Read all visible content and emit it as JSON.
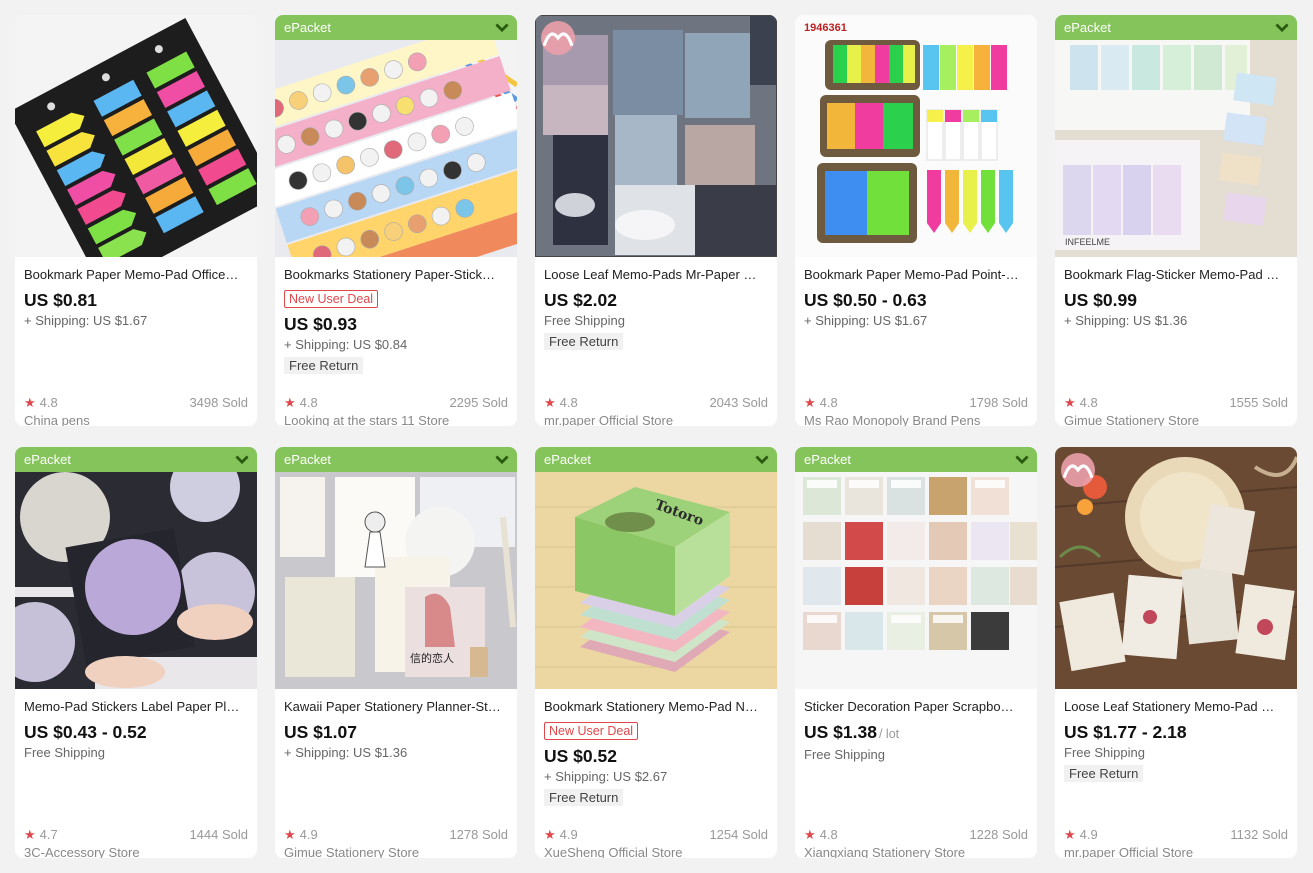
{
  "colors": {
    "epacket_bg": "#84c45a",
    "deal_red": "#e0484b",
    "star_red": "#e0484b"
  },
  "products": [
    {
      "title": "Bookmark Paper Memo-Pad Office…",
      "epacket": "",
      "deal": "",
      "price": "US $0.81",
      "unit": "",
      "shipping": "+ Shipping: US $1.67",
      "free_return": "",
      "rating": "4.8",
      "sold": "3498 Sold",
      "store": "China pens",
      "image": "neon-arrow-flags-on-black-card"
    },
    {
      "title": "Bookmarks Stationery Paper-Stick…",
      "epacket": "ePacket",
      "deal": "New User Deal",
      "price": "US $0.93",
      "unit": "",
      "shipping": "+ Shipping: US $0.84",
      "free_return": "Free Return",
      "rating": "4.8",
      "sold": "2295 Sold",
      "store": "Looking at the stars 11 Store",
      "image": "cartoon-animal-index-tabs"
    },
    {
      "title": "Loose Leaf Memo-Pads Mr-Paper …",
      "epacket": "",
      "deal": "",
      "price": "US $2.02",
      "unit": "",
      "shipping": "Free Shipping",
      "free_return": "Free Return",
      "rating": "4.8",
      "sold": "2043 Sold",
      "store": "mr.paper Official Store",
      "image": "sky-photo-memo-pads"
    },
    {
      "title": "Bookmark Paper Memo-Pad Point-…",
      "epacket": "",
      "deal": "",
      "price": "US $0.50 - 0.63",
      "unit": "",
      "shipping": "+ Shipping: US $1.67",
      "free_return": "",
      "rating": "4.8",
      "sold": "1798 Sold",
      "store": "Ms Rao Monopoly Brand Pens",
      "image": "colorful-sticky-flag-sets",
      "sku": "1946361"
    },
    {
      "title": "Bookmark Flag-Sticker Memo-Pad …",
      "epacket": "ePacket",
      "deal": "",
      "price": "US $0.99",
      "unit": "",
      "shipping": "+ Shipping: US $1.36",
      "free_return": "",
      "rating": "4.8",
      "sold": "1555 Sold",
      "store": "Gimue Stationery Store",
      "image": "pastel-flag-sticker-sheets"
    },
    {
      "title": "Memo-Pad Stickers Label Paper Pl…",
      "epacket": "ePacket",
      "deal": "",
      "price": "US $0.43 - 0.52",
      "unit": "",
      "shipping": "Free Shipping",
      "free_return": "",
      "rating": "4.7",
      "sold": "1444 Sold",
      "store": "3C-Accessory Store",
      "image": "moon-round-memo-stickers"
    },
    {
      "title": "Kawaii Paper Stationery Planner-St…",
      "epacket": "ePacket",
      "deal": "",
      "price": "US $1.07",
      "unit": "",
      "shipping": "+ Shipping: US $1.36",
      "free_return": "",
      "rating": "4.9",
      "sold": "1278 Sold",
      "store": "Gimue Stationery Store",
      "image": "girl-illustration-sticky-notes"
    },
    {
      "title": "Bookmark Stationery Memo-Pad N…",
      "epacket": "ePacket",
      "deal": "New User Deal",
      "price": "US $0.52",
      "unit": "",
      "shipping": "+ Shipping: US $2.67",
      "free_return": "Free Return",
      "rating": "4.9",
      "sold": "1254 Sold",
      "store": "XueSheng Official Store",
      "image": "totoro-memo-pad-stack"
    },
    {
      "title": "Sticker Decoration Paper Scrapbo…",
      "epacket": "ePacket",
      "deal": "",
      "price": "US $1.38",
      "unit": "/ lot",
      "shipping": "Free Shipping",
      "free_return": "",
      "rating": "4.8",
      "sold": "1228 Sold",
      "store": "Xiangxiang Stationery Store",
      "image": "label-sticker-boxes-grid"
    },
    {
      "title": "Loose Leaf Stationery Memo-Pad …",
      "epacket": "",
      "deal": "",
      "price": "US $1.77 - 2.18",
      "unit": "",
      "shipping": "Free Shipping",
      "free_return": "Free Return",
      "rating": "4.9",
      "sold": "1132 Sold",
      "store": "mr.paper Official Store",
      "image": "botanical-vintage-memo-paper"
    }
  ]
}
